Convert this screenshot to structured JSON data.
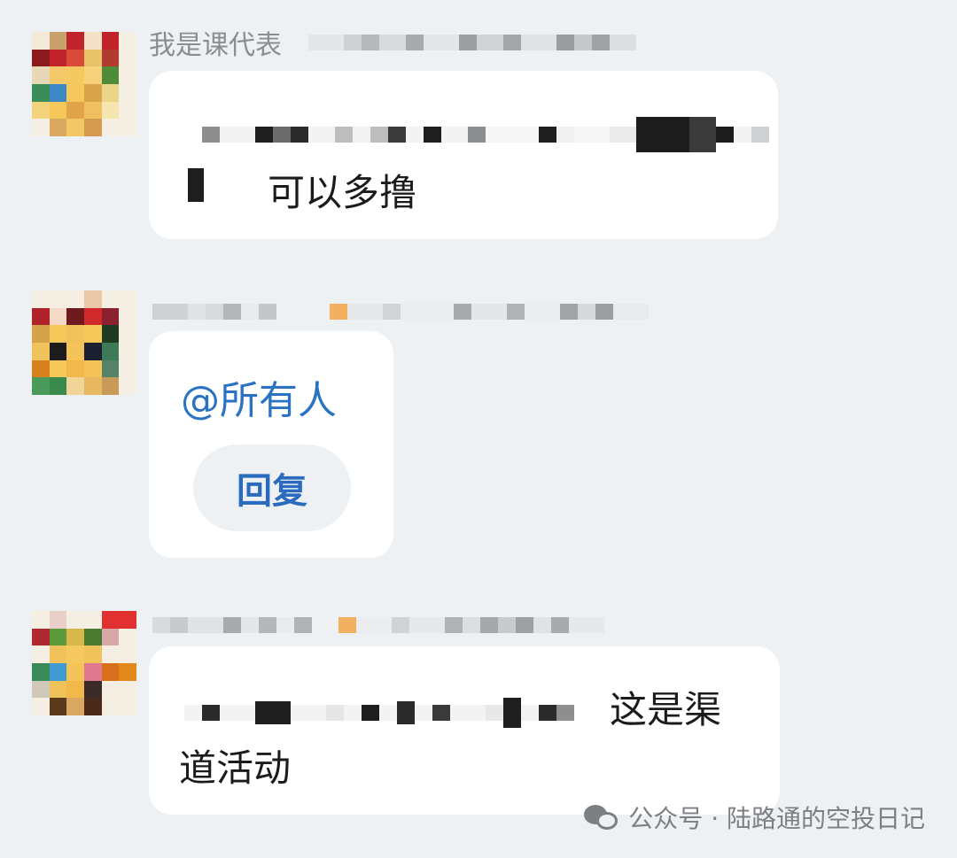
{
  "messages": [
    {
      "sender": "我是课代表",
      "text": "可以多撸"
    },
    {
      "mention": "@所有人",
      "reply_button": "回复"
    },
    {
      "text_line1": "这是渠",
      "text_line2": "道活动"
    }
  ],
  "watermark": "公众号 · 陆路通的空投日记",
  "colors": {
    "background": "#eef1f3",
    "bubble": "#ffffff",
    "mention": "#2a72c4",
    "reply": "#2a6bc0",
    "sender": "#8a8d91"
  },
  "icons": [
    "wechat-icon"
  ]
}
